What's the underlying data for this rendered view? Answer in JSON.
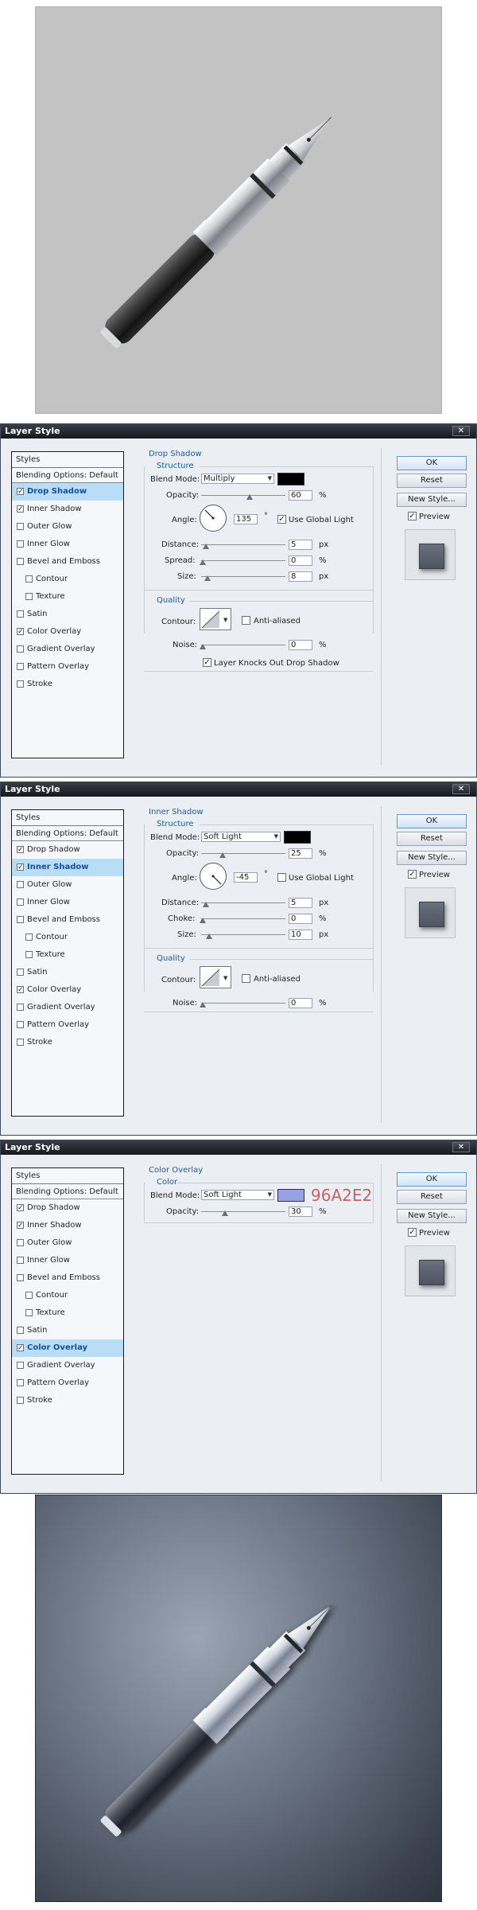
{
  "canvas_top": {
    "background": "#c3c3c3"
  },
  "canvas_bottom": {
    "background": "#5c6473"
  },
  "common": {
    "window_title": "Layer Style",
    "close_glyph": "✕",
    "styles_header": "Styles",
    "blending_options": "Blending Options: Default",
    "style_items": [
      "Drop Shadow",
      "Inner Shadow",
      "Outer Glow",
      "Inner Glow",
      "Bevel and Emboss",
      "Contour",
      "Texture",
      "Satin",
      "Color Overlay",
      "Gradient Overlay",
      "Pattern Overlay",
      "Stroke"
    ],
    "buttons": {
      "ok": "OK",
      "reset": "Reset",
      "new_style": "New Style...",
      "preview": "Preview"
    },
    "check_glyph": "✓"
  },
  "dialog1": {
    "checked": [
      true,
      true,
      false,
      false,
      false,
      false,
      false,
      false,
      true,
      false,
      false,
      false
    ],
    "selected_index": 0,
    "section": "Drop Shadow",
    "structure": "Structure",
    "blend_mode_label": "Blend Mode:",
    "blend_mode_value": "Multiply",
    "swatch_color": "#000000",
    "opacity_label": "Opacity:",
    "opacity_value": "60",
    "percent": "%",
    "angle_label": "Angle:",
    "angle_value": "135",
    "degree": "°",
    "use_global_light": "Use Global Light",
    "use_global_light_checked": true,
    "distance_label": "Distance:",
    "distance_value": "5",
    "spread_label": "Spread:",
    "spread_value": "0",
    "size_label": "Size:",
    "size_value": "8",
    "px": "px",
    "quality": "Quality",
    "contour_label": "Contour:",
    "anti_aliased": "Anti-aliased",
    "noise_label": "Noise:",
    "noise_value": "0",
    "knockout": "Layer Knocks Out Drop Shadow"
  },
  "dialog2": {
    "checked": [
      true,
      true,
      false,
      false,
      false,
      false,
      false,
      false,
      true,
      false,
      false,
      false
    ],
    "selected_index": 1,
    "section": "Inner Shadow",
    "structure": "Structure",
    "blend_mode_label": "Blend Mode:",
    "blend_mode_value": "Soft Light",
    "swatch_color": "#000000",
    "opacity_label": "Opacity:",
    "opacity_value": "25",
    "percent": "%",
    "angle_label": "Angle:",
    "angle_value": "-45",
    "degree": "°",
    "use_global_light": "Use Global Light",
    "use_global_light_checked": false,
    "distance_label": "Distance:",
    "distance_value": "5",
    "choke_label": "Choke:",
    "choke_value": "0",
    "size_label": "Size:",
    "size_value": "10",
    "px": "px",
    "quality": "Quality",
    "contour_label": "Contour:",
    "anti_aliased": "Anti-aliased",
    "noise_label": "Noise:",
    "noise_value": "0"
  },
  "dialog3": {
    "checked": [
      true,
      true,
      false,
      false,
      false,
      false,
      false,
      false,
      true,
      false,
      false,
      false
    ],
    "selected_index": 8,
    "section": "Color Overlay",
    "color_legend": "Color",
    "blend_mode_label": "Blend Mode:",
    "blend_mode_value": "Soft Light",
    "swatch_color": "#96A2E2",
    "hex_text": "96A2E2",
    "opacity_label": "Opacity:",
    "opacity_value": "30",
    "percent": "%"
  }
}
